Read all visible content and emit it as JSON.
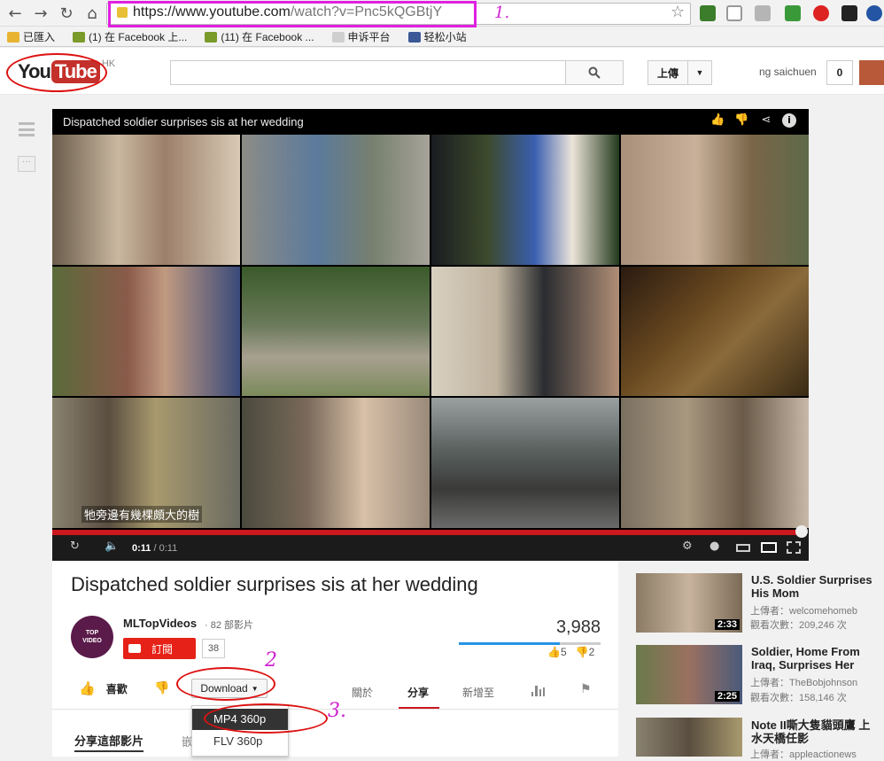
{
  "browser": {
    "url_main": "https://www.youtube.com",
    "url_path": "/watch?v=Pnc5kQGBtjY",
    "bookmarks": [
      {
        "label": "已匯入",
        "icon": "folder-icon",
        "color": "#e8b330"
      },
      {
        "label": "(1) 在 Facebook 上...",
        "icon": "facebook-game-icon",
        "color": "#7a9a2a"
      },
      {
        "label": "(11) 在 Facebook ...",
        "icon": "facebook-game-icon",
        "color": "#7a9a2a"
      },
      {
        "label": "申诉平台",
        "icon": "page-icon",
        "color": "#cfcfcf"
      },
      {
        "label": "轻松小站",
        "icon": "facebook-icon",
        "color": "#3b5998"
      }
    ]
  },
  "header": {
    "logo_you": "You",
    "logo_tube": "Tube",
    "logo_region": "HK",
    "upload_label": "上傳",
    "username": "ng saichuen",
    "notifications": "0"
  },
  "player": {
    "title": "Dispatched soldier surprises sis at her wedding",
    "caption": "牠旁邊有幾棵頗大的樹",
    "time_current": "0:11",
    "time_total": " / 0:11",
    "progress": 1.0
  },
  "video": {
    "title": "Dispatched soldier surprises sis at her wedding",
    "channel": "MLTopVideos",
    "channel_count": "· 82 部影片",
    "avatar_line1": "TOP",
    "avatar_line2": "VIDEO",
    "subscribe_label": "訂閱",
    "subscribers": "38",
    "views": "3,988",
    "likes": "5",
    "dislikes": "2",
    "like_ratio": 0.71,
    "like_label": "喜歡",
    "download_label": "Download",
    "tabs": [
      "關於",
      "分享",
      "新增至"
    ],
    "share_heading": "分享這部影片",
    "share_next": "嵌"
  },
  "download_menu": [
    "MP4 360p",
    "FLV 360p"
  ],
  "annotations": [
    "1.",
    "2",
    "3."
  ],
  "related": [
    {
      "title": "U.S. Soldier Surprises His Mom",
      "uploader": "上傳者：welcomehomeb",
      "views": "觀看次數：209,246 次",
      "duration": "2:33"
    },
    {
      "title": "Soldier, Home From Iraq, Surprises Her",
      "uploader": "上傳者：TheBobjohnson",
      "views": "觀看次數：158,146 次",
      "duration": "2:25"
    },
    {
      "title": "Note II嘶大隻貓頭鷹 上水天橋任影",
      "uploader": "上傳者：appleactionews",
      "views": "",
      "duration": ""
    }
  ],
  "colors": {
    "accent": "#cc181e",
    "annotation": "#d020d0",
    "subscribe": "#e62117"
  }
}
